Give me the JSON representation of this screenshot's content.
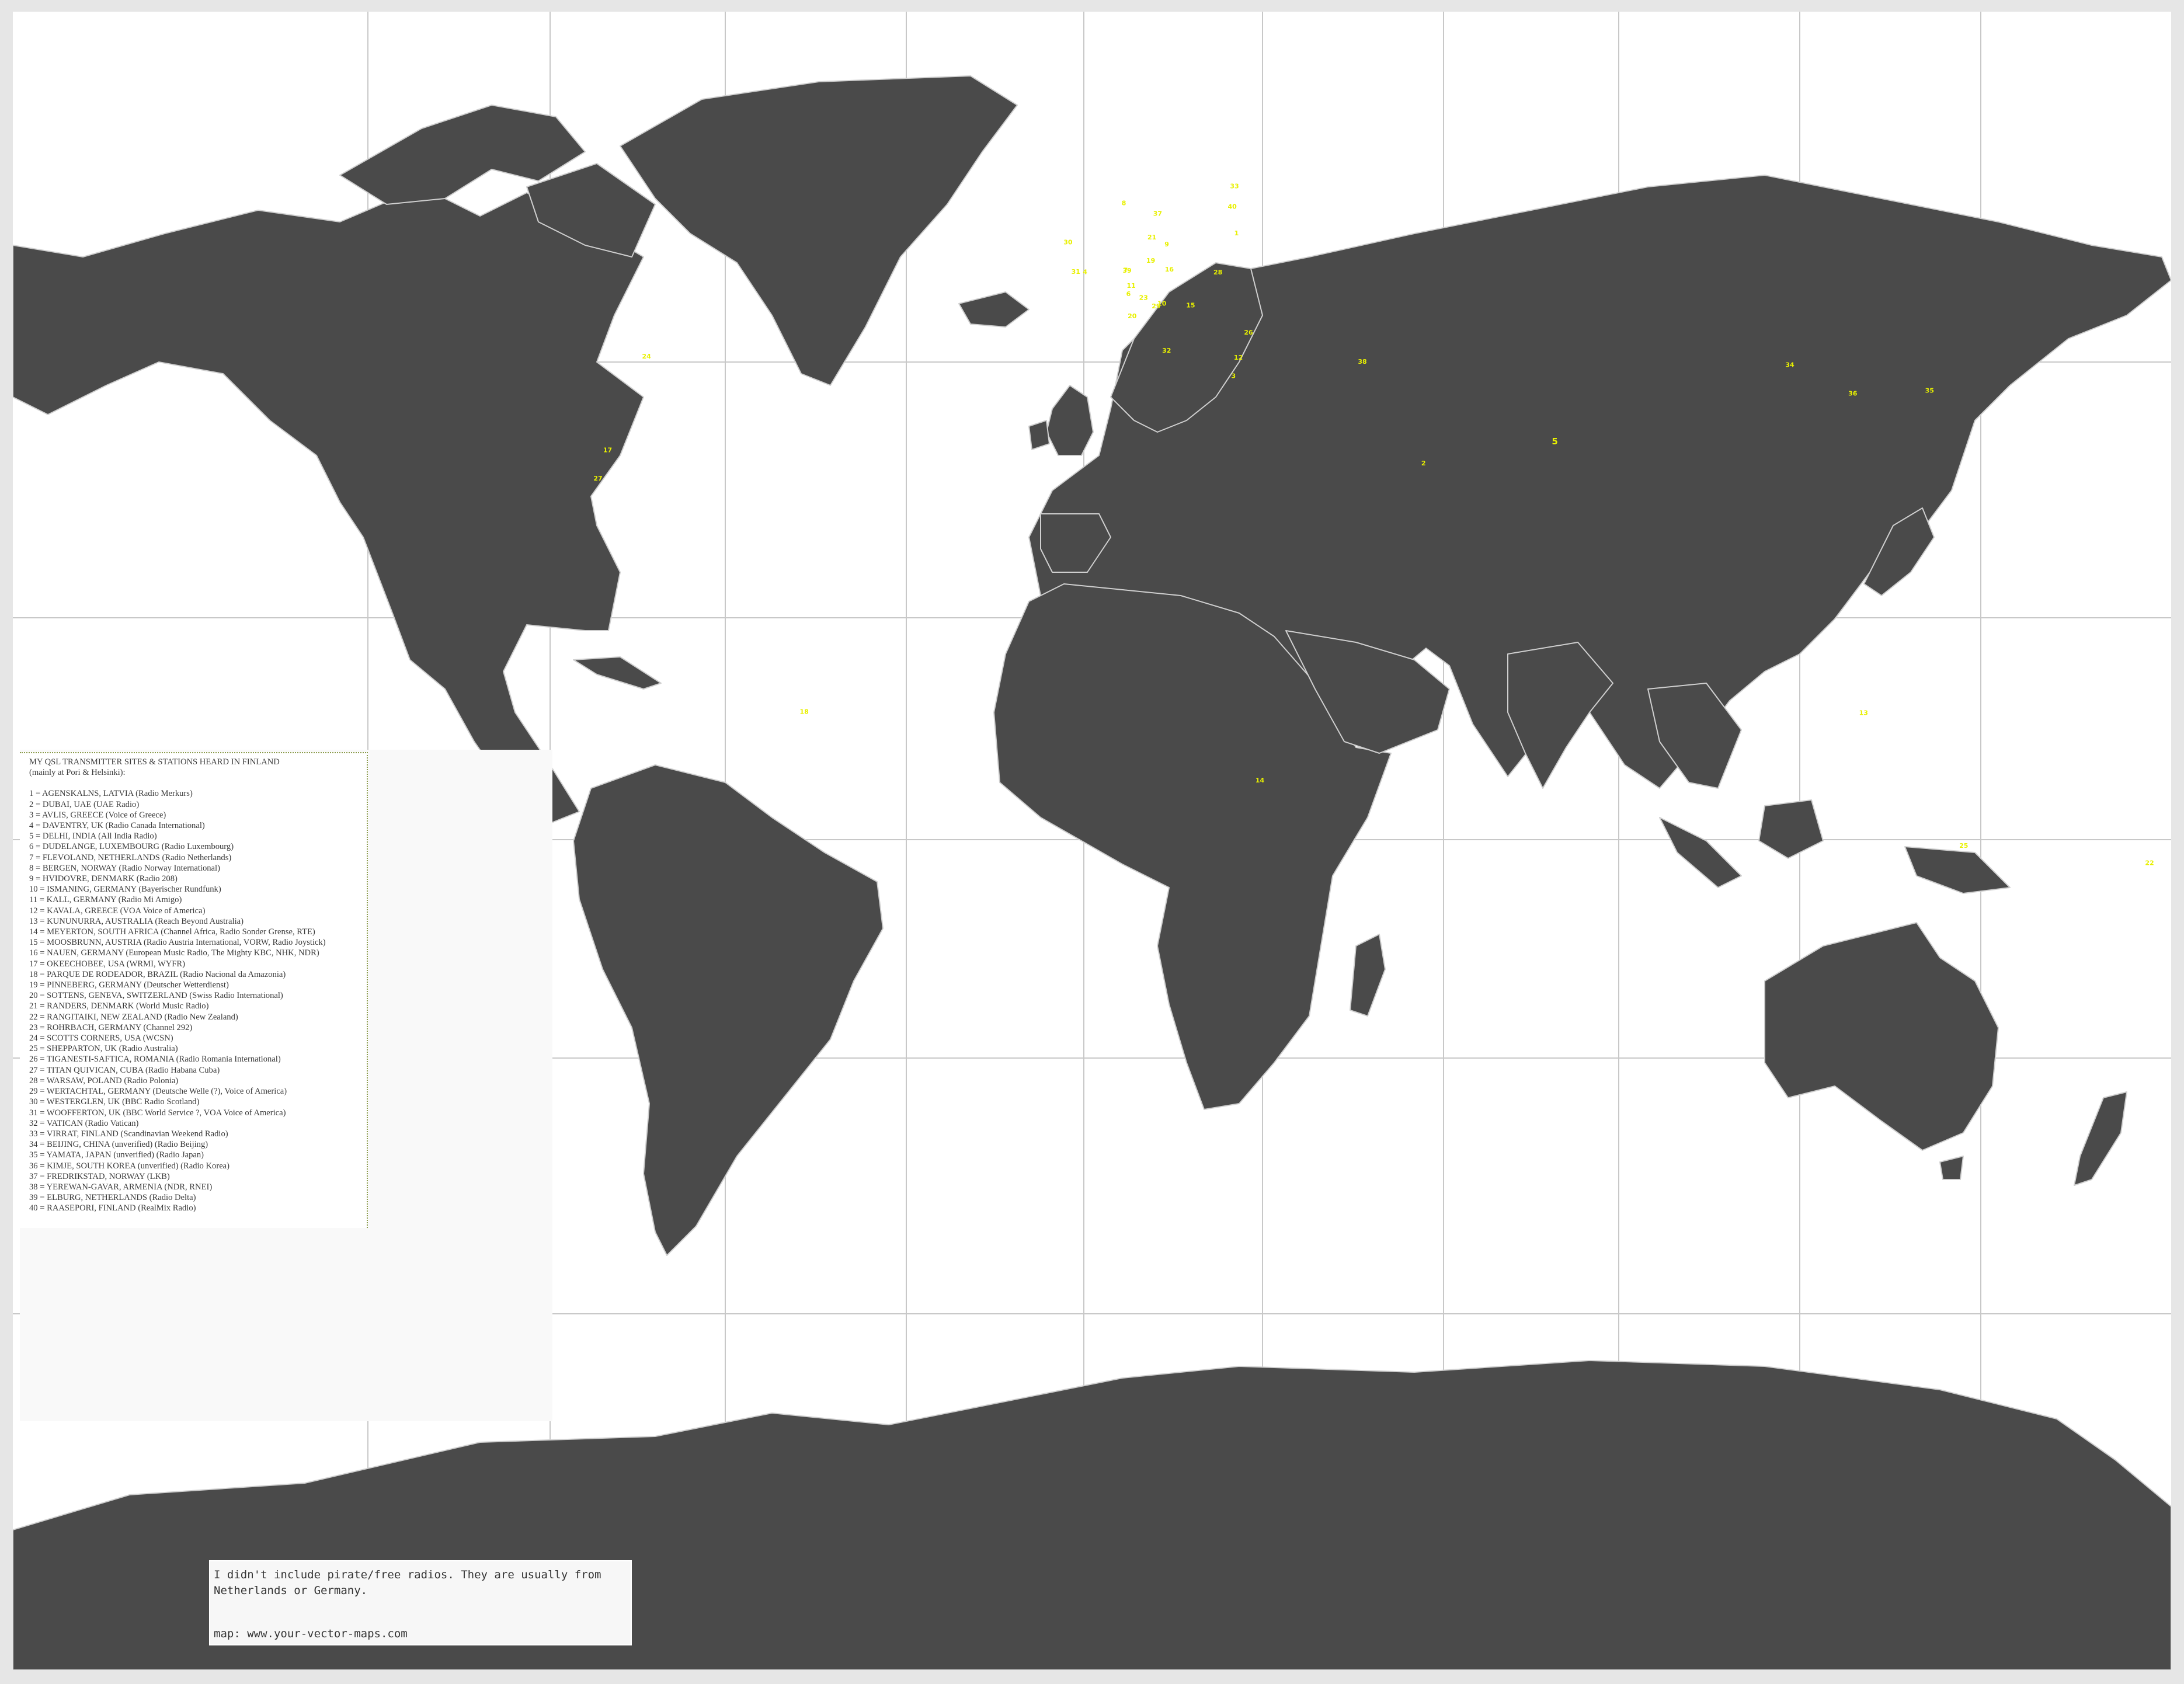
{
  "colors": {
    "land": "#4a4a4a",
    "ocean": "#ffffff",
    "borders": "#cfcfcf",
    "markers": "#e8f000",
    "grid": "#c8c8c8"
  },
  "legend": {
    "title": "MY QSL TRANSMITTER SITES & STATIONS HEARD IN FINLAND",
    "subtitle": "(mainly at Pori & Helsinki):",
    "entries": [
      "1 = AGENSKALNS, LATVIA (Radio Merkurs)",
      "2 = DUBAI, UAE (UAE Radio)",
      "3 = AVLIS, GREECE (Voice of Greece)",
      "4 = DAVENTRY, UK (Radio Canada International)",
      "5 = DELHI, INDIA (All India Radio)",
      "6 = DUDELANGE, LUXEMBOURG (Radio Luxembourg)",
      "7 = FLEVOLAND, NETHERLANDS (Radio Netherlands)",
      "8 = BERGEN, NORWAY (Radio Norway International)",
      "9 = HVIDOVRE, DENMARK (Radio 208)",
      "10 = ISMANING, GERMANY (Bayerischer Rundfunk)",
      "11 = KALL, GERMANY (Radio Mi Amigo)",
      "12 = KAVALA, GREECE (VOA Voice of America)",
      "13 = KUNUNURRA, AUSTRALIA (Reach Beyond Australia)",
      "14 = MEYERTON, SOUTH AFRICA (Channel Africa, Radio Sonder Grense, RTE)",
      "15 = MOOSBRUNN, AUSTRIA (Radio Austria International, VORW, Radio Joystick)",
      "16 = NAUEN, GERMANY (European Music Radio, The Mighty KBC, NHK, NDR)",
      "17 = OKEECHOBEE, USA (WRMI, WYFR)",
      "18 = PARQUE DE RODEADOR, BRAZIL (Radio Nacional da Amazonia)",
      "19 = PINNEBERG, GERMANY (Deutscher Wetterdienst)",
      "20 = SOTTENS, GENEVA, SWITZERLAND (Swiss Radio International)",
      "21 = RANDERS, DENMARK (World Music Radio)",
      "22 = RANGITAIKI, NEW ZEALAND (Radio New Zealand)",
      "23 = ROHRBACH, GERMANY (Channel 292)",
      "24 = SCOTTS CORNERS, USA (WCSN)",
      "25 = SHEPPARTON, UK (Radio Australia)",
      "26 = TIGANESTI-SAFTICA, ROMANIA (Radio Romania International)",
      "27 = TITAN QUIVICAN, CUBA (Radio Habana Cuba)",
      "28 = WARSAW, POLAND (Radio Polonia)",
      "29 = WERTACHTAL, GERMANY (Deutsche Welle (?), Voice of America)",
      "30 = WESTERGLEN, UK (BBC Radio Scotland)",
      "31 = WOOFFERTON, UK (BBC World Service ?, VOA Voice of America)",
      "32 = VATICAN (Radio Vatican)",
      "33 = VIRRAT, FINLAND (Scandinavian Weekend Radio)",
      "34 = BEIJING, CHINA (unverified) (Radio Beijing)",
      "35 = YAMATA, JAPAN (unverified) (Radio Japan)",
      "36 = KIMJE, SOUTH KOREA (unverified) (Radio Korea)",
      "37 = FREDRIKSTAD, NORWAY (LKB)",
      "38 = YEREWAN-GAVAR, ARMENIA (NDR, RNEI)",
      "39 = ELBURG, NETHERLANDS (Radio Delta)",
      "40 = RAASEPORI, FINLAND (RealMix Radio)"
    ]
  },
  "note": {
    "line1": "I didn't include pirate/free radios. They are usually from",
    "line2": "Netherlands or Germany.",
    "source": "map: www.your-vector-maps.com"
  },
  "markers": [
    {
      "label": "1",
      "lon": 24.1,
      "lat": 56.95
    },
    {
      "label": "2",
      "lon": 55.3,
      "lat": 25.2
    },
    {
      "label": "3",
      "lon": 23.6,
      "lat": 38.3
    },
    {
      "label": "4",
      "lon": -1.16,
      "lat": 52.26
    },
    {
      "label": "5",
      "lon": 77.2,
      "lat": 28.6
    },
    {
      "label": "6",
      "lon": 6.08,
      "lat": 49.48
    },
    {
      "label": "7",
      "lon": 5.6,
      "lat": 52.5
    },
    {
      "label": "8",
      "lon": 5.32,
      "lat": 60.39
    },
    {
      "label": "9",
      "lon": 12.48,
      "lat": 55.64
    },
    {
      "label": "10",
      "lon": 11.67,
      "lat": 48.23
    },
    {
      "label": "11",
      "lon": 6.55,
      "lat": 50.55
    },
    {
      "label": "12",
      "lon": 24.4,
      "lat": 40.94
    },
    {
      "label": "13",
      "lon": 128.7,
      "lat": -15.8
    },
    {
      "label": "14",
      "lon": 28.0,
      "lat": -26.56
    },
    {
      "label": "15",
      "lon": 16.45,
      "lat": 48.02
    },
    {
      "label": "16",
      "lon": 12.9,
      "lat": 52.6
    },
    {
      "label": "17",
      "lon": -80.8,
      "lat": 27.25
    },
    {
      "label": "18",
      "lon": -48.0,
      "lat": -15.6
    },
    {
      "label": "19",
      "lon": 9.8,
      "lat": 53.66
    },
    {
      "label": "20",
      "lon": 6.7,
      "lat": 46.6
    },
    {
      "label": "21",
      "lon": 10.0,
      "lat": 56.46
    },
    {
      "label": "22",
      "lon": 176.4,
      "lat": -38.9
    },
    {
      "label": "23",
      "lon": 8.6,
      "lat": 49.0
    },
    {
      "label": "24",
      "lon": -74.3,
      "lat": 41.1
    },
    {
      "label": "25",
      "lon": 145.4,
      "lat": -36.4
    },
    {
      "label": "26",
      "lon": 26.1,
      "lat": 44.4
    },
    {
      "label": "27",
      "lon": -82.4,
      "lat": 22.8
    },
    {
      "label": "28",
      "lon": 21.0,
      "lat": 52.23
    },
    {
      "label": "29",
      "lon": 10.7,
      "lat": 47.9
    },
    {
      "label": "30",
      "lon": -4.0,
      "lat": 55.9
    },
    {
      "label": "31",
      "lon": -2.7,
      "lat": 52.3
    },
    {
      "label": "32",
      "lon": 12.45,
      "lat": 41.9
    },
    {
      "label": "33",
      "lon": 23.77,
      "lat": 62.24
    },
    {
      "label": "34",
      "lon": 116.4,
      "lat": 39.9
    },
    {
      "label": "35",
      "lon": 139.7,
      "lat": 36.2
    },
    {
      "label": "36",
      "lon": 126.9,
      "lat": 35.8
    },
    {
      "label": "37",
      "lon": 10.95,
      "lat": 59.2
    },
    {
      "label": "38",
      "lon": 45.1,
      "lat": 40.35
    },
    {
      "label": "39",
      "lon": 5.84,
      "lat": 52.44
    },
    {
      "label": "40",
      "lon": 23.4,
      "lat": 60.0
    }
  ]
}
